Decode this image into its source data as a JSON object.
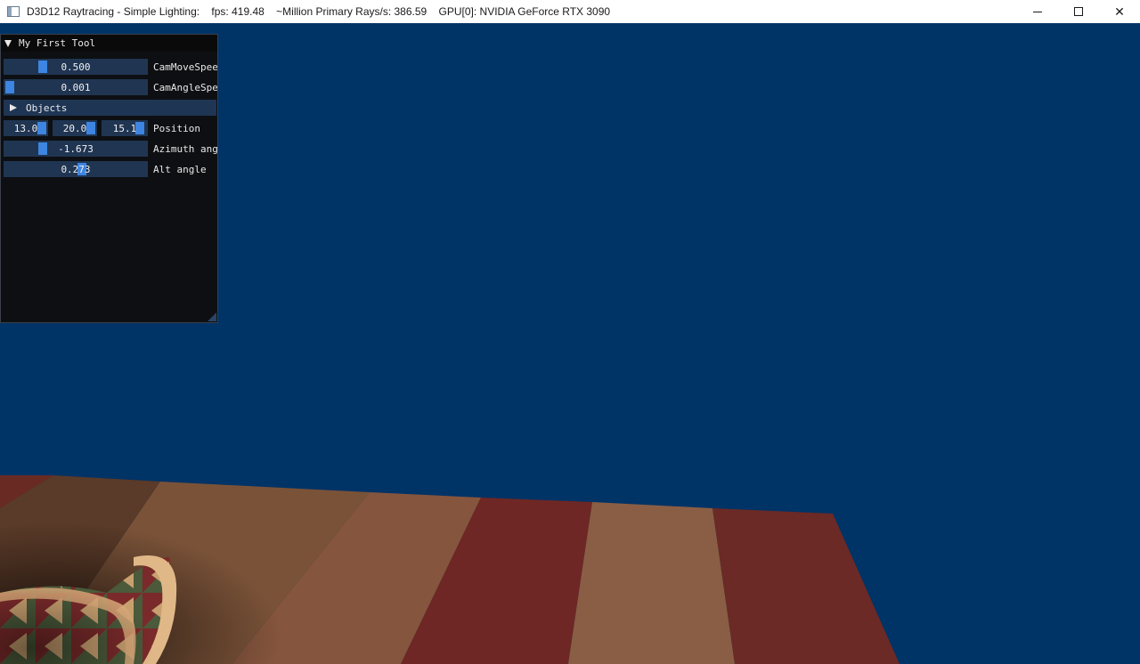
{
  "window": {
    "title": "D3D12 Raytracing - Simple Lighting:    fps: 419.48    ~Million Primary Rays/s: 386.59    GPU[0]: NVIDIA GeForce RTX 3090",
    "icon": "app-window-icon",
    "controls": {
      "minimize": "minimize-icon",
      "maximize": "maximize-icon",
      "close_glyph": "✕"
    }
  },
  "tool_window": {
    "title": "My First Tool",
    "cam_move_speed": {
      "value": "0.500",
      "label": "CamMoveSpeed",
      "level": 0.25
    },
    "cam_angle_speed": {
      "value": "0.001",
      "label": "CamAngleSpeed",
      "level": 0.0
    },
    "objects": {
      "label": "Objects",
      "expanded": false
    },
    "position": {
      "x": "13.0",
      "y": "20.0",
      "z": "15.1",
      "label": "Position"
    },
    "azimuth": {
      "value": "-1.673",
      "label": "Azimuth angle",
      "level": 0.25
    },
    "alt_angle": {
      "value": "0.273",
      "label": "Alt angle",
      "level": 0.55
    }
  },
  "scene": {
    "background_color": "#003366",
    "floor_colors": [
      "#6a2a24",
      "#8a6a4a",
      "#a87a5a",
      "#9a5a40"
    ]
  }
}
